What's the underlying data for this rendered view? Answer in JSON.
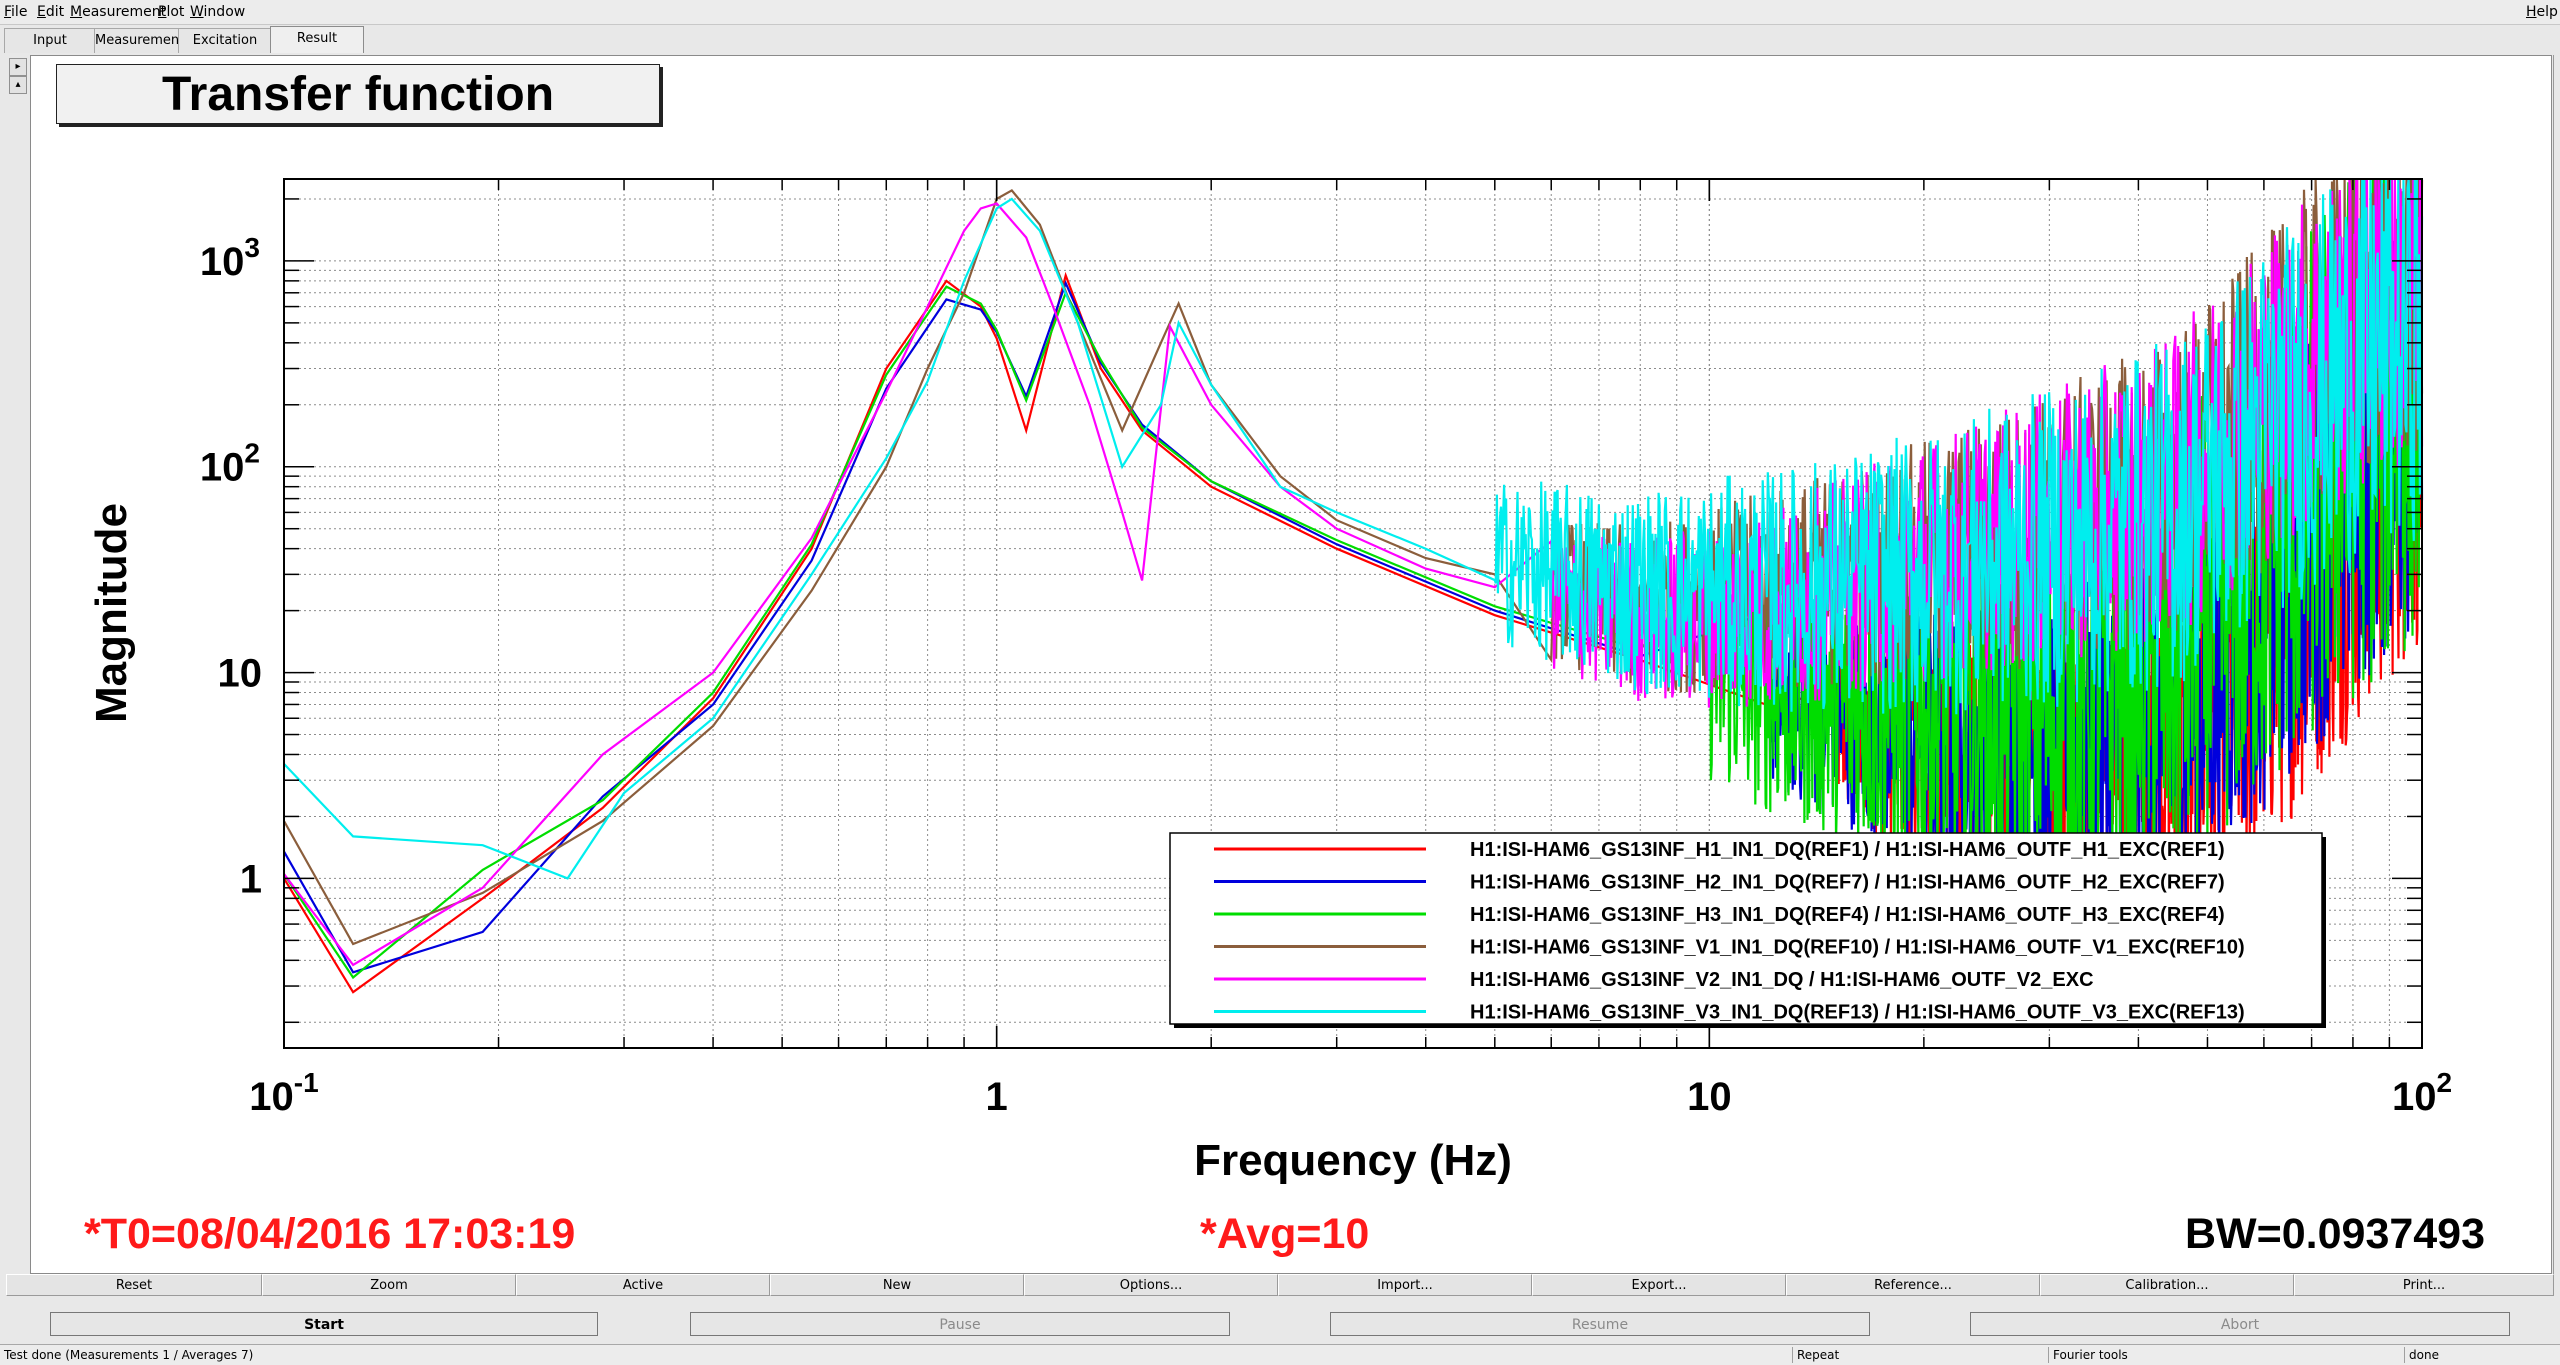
{
  "menu": [
    "File",
    "Edit",
    "Measurement",
    "Plot",
    "Window"
  ],
  "help": "Help",
  "tabs": [
    "Input",
    "Measurement",
    "Excitation",
    "Result"
  ],
  "active_tab": "Result",
  "panel_title": "Transfer function",
  "status": {
    "t0": "*T0=08/04/2016 17:03:19",
    "avg": "*Avg=10",
    "bw": "BW=0.0937493"
  },
  "toolbar": [
    "Reset",
    "Zoom",
    "Active",
    "New",
    "Options...",
    "Import...",
    "Export...",
    "Reference...",
    "Calibration...",
    "Print..."
  ],
  "controls": [
    "Start",
    "Pause",
    "Resume",
    "Abort"
  ],
  "statusbar": {
    "message": "Test done (Measurements 1 / Averages 7)",
    "mode": "Repeat",
    "tool": "Fourier tools",
    "state": "done"
  },
  "colors": {
    "background": "#ffffff",
    "grid": "#8c8c8c",
    "status_red": "#ff1a1a"
  },
  "chart_data": {
    "type": "line",
    "xscale": "log",
    "yscale": "log",
    "xlim": [
      0.1,
      100
    ],
    "ylim": [
      0.15,
      2500
    ],
    "xlabel": "Frequency (Hz)",
    "ylabel": "Magnitude",
    "x_ticks": [
      {
        "base": "10",
        "exp": "-1",
        "value": 0.1
      },
      {
        "base": "1",
        "exp": "",
        "value": 1
      },
      {
        "base": "10",
        "exp": "",
        "value": 10
      },
      {
        "base": "10",
        "exp": "2",
        "value": 100
      }
    ],
    "y_ticks": [
      {
        "base": "1",
        "exp": "",
        "value": 1
      },
      {
        "base": "10",
        "exp": "",
        "value": 10
      },
      {
        "base": "10",
        "exp": "2",
        "value": 100
      },
      {
        "base": "10",
        "exp": "3",
        "value": 1000
      }
    ],
    "grid": true,
    "legend_position": "bottom-right",
    "series": [
      {
        "name": "H1:ISI-HAM6_GS13INF_H1_IN1_DQ(REF1) / H1:ISI-HAM6_OUTF_H1_EXC(REF1)",
        "color": "#ff0000",
        "x": [
          0.1,
          0.125,
          0.19,
          0.28,
          0.4,
          0.55,
          0.7,
          0.85,
          0.95,
          1.0,
          1.1,
          1.25,
          1.4,
          1.6,
          2.0,
          3.0,
          5.0,
          8.0,
          12,
          20,
          30,
          45,
          60,
          80,
          100
        ],
        "y": [
          1.0,
          0.28,
          0.8,
          2.2,
          7.5,
          40,
          300,
          800,
          600,
          420,
          150,
          850,
          300,
          150,
          80,
          40,
          19,
          11.5,
          7.0,
          4.5,
          3.2,
          4.0,
          12,
          60,
          200
        ],
        "noise_from": 15,
        "noise_amp": 0.45
      },
      {
        "name": "H1:ISI-HAM6_GS13INF_H2_IN1_DQ(REF7) / H1:ISI-HAM6_OUTF_H2_EXC(REF7)",
        "color": "#0000dd",
        "x": [
          0.1,
          0.125,
          0.19,
          0.28,
          0.4,
          0.55,
          0.7,
          0.85,
          0.95,
          1.0,
          1.1,
          1.25,
          1.4,
          1.6,
          2.0,
          3.0,
          5.0,
          8.0,
          12,
          20,
          30,
          45,
          60,
          80,
          100
        ],
        "y": [
          1.35,
          0.35,
          0.55,
          2.5,
          7.0,
          35,
          240,
          650,
          580,
          450,
          220,
          780,
          320,
          160,
          85,
          42,
          20,
          12,
          7.5,
          5.0,
          4.0,
          6.0,
          20,
          90,
          250
        ],
        "noise_from": 12,
        "noise_amp": 0.45
      },
      {
        "name": "H1:ISI-HAM6_GS13INF_H3_IN1_DQ(REF4) / H1:ISI-HAM6_OUTF_H3_EXC(REF4)",
        "color": "#00dd00",
        "x": [
          0.1,
          0.125,
          0.19,
          0.28,
          0.4,
          0.55,
          0.7,
          0.85,
          0.95,
          1.0,
          1.1,
          1.25,
          1.4,
          1.6,
          2.0,
          3.0,
          5.0,
          8.0,
          12,
          20,
          30,
          45,
          60,
          80,
          100
        ],
        "y": [
          1.05,
          0.33,
          1.1,
          2.4,
          8.0,
          42,
          280,
          750,
          620,
          460,
          210,
          700,
          330,
          155,
          85,
          44,
          21,
          13,
          8.5,
          6.5,
          7.0,
          12,
          40,
          150,
          350
        ],
        "noise_from": 10,
        "noise_amp": 0.55
      },
      {
        "name": "H1:ISI-HAM6_GS13INF_V1_IN1_DQ(REF10) / H1:ISI-HAM6_OUTF_V1_EXC(REF10)",
        "color": "#8b5e3c",
        "x": [
          0.1,
          0.125,
          0.19,
          0.28,
          0.4,
          0.55,
          0.7,
          0.8,
          0.9,
          1.0,
          1.05,
          1.15,
          1.3,
          1.5,
          1.7,
          1.8,
          2.0,
          2.5,
          3.0,
          4.0,
          5.0,
          8.0,
          12,
          20,
          30,
          45,
          60,
          80,
          100
        ],
        "y": [
          1.9,
          0.48,
          0.85,
          1.9,
          5.5,
          25,
          100,
          300,
          700,
          2000,
          2200,
          1500,
          500,
          150,
          400,
          620,
          250,
          90,
          55,
          36,
          30,
          20,
          25,
          35,
          50,
          80,
          200,
          600,
          800
        ],
        "noise_from": 6,
        "noise_amp": 0.35
      },
      {
        "name": "H1:ISI-HAM6_GS13INF_V2_IN1_DQ / H1:ISI-HAM6_OUTF_V2_EXC",
        "color": "#ff00ff",
        "x": [
          0.1,
          0.125,
          0.19,
          0.28,
          0.4,
          0.55,
          0.7,
          0.8,
          0.9,
          0.95,
          1.0,
          1.1,
          1.2,
          1.35,
          1.5,
          1.6,
          1.75,
          2.0,
          2.5,
          3.0,
          4.0,
          5.0,
          8.0,
          12,
          20,
          30,
          45,
          60,
          80,
          100
        ],
        "y": [
          1.05,
          0.38,
          0.9,
          4.0,
          10,
          45,
          230,
          600,
          1400,
          1800,
          1900,
          1300,
          600,
          200,
          60,
          28,
          480,
          200,
          80,
          50,
          32,
          26,
          18,
          20,
          35,
          50,
          80,
          220,
          500,
          800
        ],
        "noise_from": 6,
        "noise_amp": 0.35
      },
      {
        "name": "H1:ISI-HAM6_GS13INF_V3_IN1_DQ(REF13) / H1:ISI-HAM6_OUTF_V3_EXC(REF13)",
        "color": "#00eeee",
        "x": [
          0.1,
          0.125,
          0.19,
          0.25,
          0.3,
          0.4,
          0.55,
          0.7,
          0.8,
          0.9,
          1.0,
          1.05,
          1.15,
          1.3,
          1.5,
          1.7,
          1.8,
          2.0,
          2.5,
          3.0,
          4.0,
          5.0,
          8.0,
          12,
          20,
          30,
          45,
          60,
          80,
          100
        ],
        "y": [
          3.6,
          1.6,
          1.45,
          1.0,
          2.6,
          6.0,
          30,
          110,
          260,
          800,
          1800,
          2000,
          1400,
          500,
          100,
          200,
          500,
          250,
          80,
          60,
          40,
          35,
          25,
          25,
          30,
          40,
          60,
          150,
          300,
          500
        ],
        "noise_from": 5,
        "noise_amp": 0.4
      }
    ]
  }
}
